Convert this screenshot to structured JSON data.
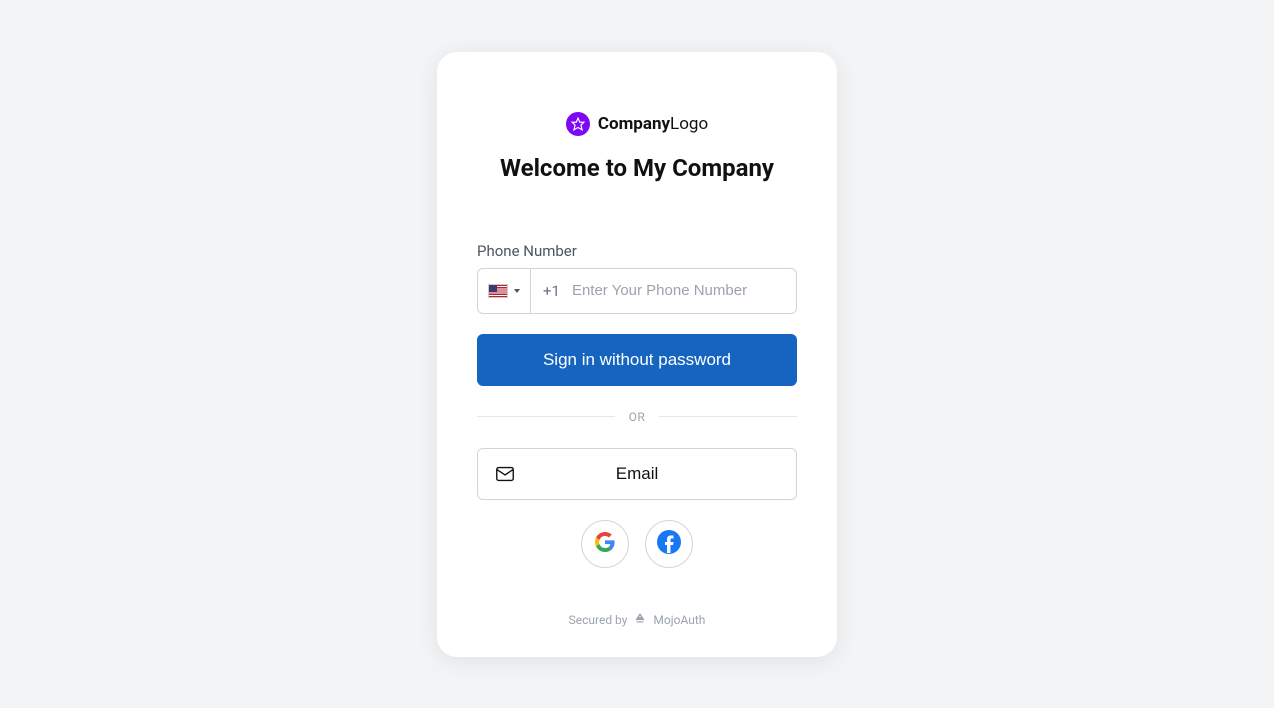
{
  "logo": {
    "bold": "Company",
    "light": "Logo"
  },
  "heading": "Welcome to My Company",
  "phone": {
    "label": "Phone Number",
    "dial_code": "+1",
    "placeholder": "Enter Your Phone Number"
  },
  "buttons": {
    "primary": "Sign in without password",
    "email": "Email"
  },
  "divider": "OR",
  "footer": {
    "secured_by": "Secured by",
    "provider": "MojoAuth"
  }
}
